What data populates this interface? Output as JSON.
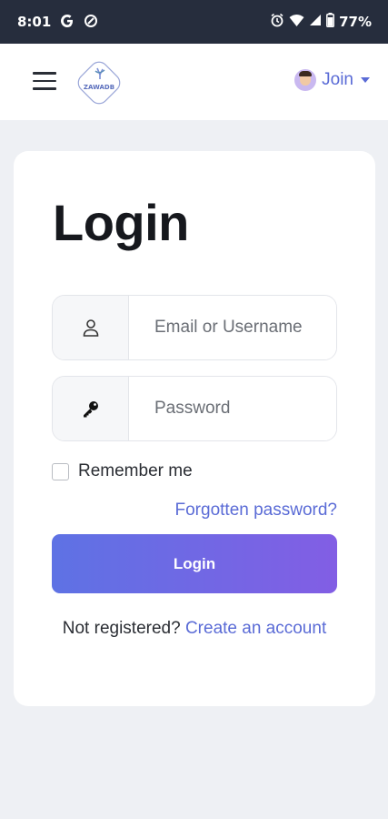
{
  "status_bar": {
    "time": "8:01",
    "battery": "77%",
    "icons": [
      "google-icon",
      "data-saver-icon",
      "alarm-icon",
      "wifi-icon",
      "signal-icon",
      "battery-icon"
    ]
  },
  "navbar": {
    "menu_icon": "hamburger-menu-icon",
    "logo_text": "ZAWADB",
    "join_label": "Join"
  },
  "login": {
    "title": "Login",
    "email_placeholder": "Email or Username",
    "password_placeholder": "Password",
    "remember_label": "Remember me",
    "remember_checked": false,
    "forgot_label": "Forgotten password?",
    "button_label": "Login",
    "not_registered": "Not registered?",
    "create_account": "Create an account"
  },
  "colors": {
    "accent": "#5a6bd6",
    "button_gradient_start": "#5e72e4",
    "button_gradient_end": "#825ee4",
    "status_bar_bg": "#262d3d",
    "page_bg": "#eef0f4"
  }
}
